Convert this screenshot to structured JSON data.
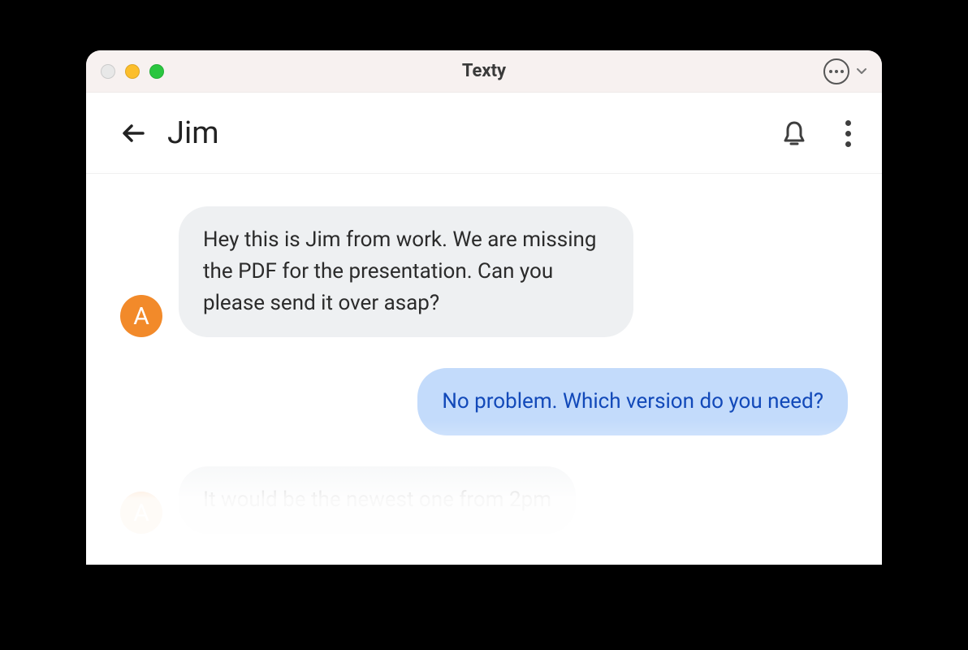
{
  "window": {
    "title": "Texty"
  },
  "header": {
    "contact_name": "Jim"
  },
  "messages": [
    {
      "direction": "received",
      "avatar_initial": "A",
      "text": "Hey this is Jim from work. We are missing the PDF for the presentation. Can you please send it over asap?"
    },
    {
      "direction": "sent",
      "text": "No problem. Which version do you need?"
    },
    {
      "direction": "received",
      "avatar_initial": "A",
      "text": "It would be the newest one from 2pm"
    }
  ]
}
